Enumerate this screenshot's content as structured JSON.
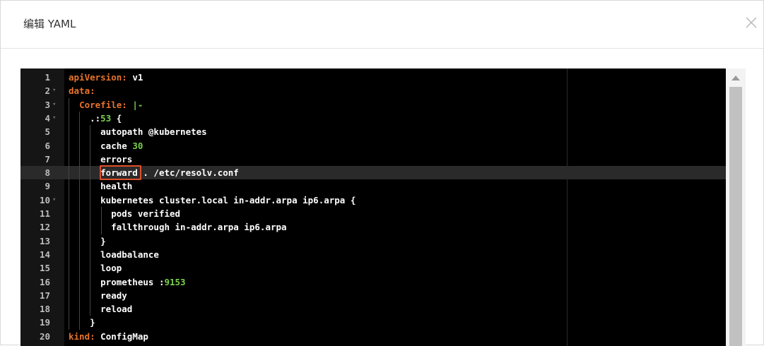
{
  "dialog": {
    "title": "编辑 YAML",
    "close_icon": "close-icon"
  },
  "editor": {
    "active_line": 8,
    "highlighted_token": "forward",
    "lines": [
      {
        "n": "1",
        "fold": false,
        "indent": "",
        "parts": [
          {
            "t": "apiVersion:",
            "c": "k"
          },
          {
            "t": " v1",
            "c": "w"
          }
        ]
      },
      {
        "n": "2",
        "fold": true,
        "indent": "",
        "parts": [
          {
            "t": "data:",
            "c": "k"
          }
        ]
      },
      {
        "n": "3",
        "fold": true,
        "indent": "  ",
        "parts": [
          {
            "t": "Corefile:",
            "c": "k"
          },
          {
            "t": " |-",
            "c": "n"
          }
        ]
      },
      {
        "n": "4",
        "fold": true,
        "indent": "    ",
        "parts": [
          {
            "t": ".:",
            "c": "w"
          },
          {
            "t": "53",
            "c": "n"
          },
          {
            "t": " {",
            "c": "w"
          }
        ]
      },
      {
        "n": "5",
        "fold": false,
        "indent": "      ",
        "parts": [
          {
            "t": "autopath @kubernetes",
            "c": "w"
          }
        ]
      },
      {
        "n": "6",
        "fold": false,
        "indent": "      ",
        "parts": [
          {
            "t": "cache ",
            "c": "w"
          },
          {
            "t": "30",
            "c": "n"
          }
        ]
      },
      {
        "n": "7",
        "fold": false,
        "indent": "      ",
        "parts": [
          {
            "t": "errors",
            "c": "w"
          }
        ]
      },
      {
        "n": "8",
        "fold": false,
        "indent": "      ",
        "parts": [
          {
            "t": "forward",
            "c": "w"
          },
          {
            "t": " . /etc/resolv.conf",
            "c": "w"
          }
        ]
      },
      {
        "n": "9",
        "fold": false,
        "indent": "      ",
        "parts": [
          {
            "t": "health",
            "c": "w"
          }
        ]
      },
      {
        "n": "10",
        "fold": true,
        "indent": "      ",
        "parts": [
          {
            "t": "kubernetes cluster.local in-addr.arpa ip6.arpa {",
            "c": "w"
          }
        ]
      },
      {
        "n": "11",
        "fold": false,
        "indent": "        ",
        "parts": [
          {
            "t": "pods verified",
            "c": "w"
          }
        ]
      },
      {
        "n": "12",
        "fold": false,
        "indent": "        ",
        "parts": [
          {
            "t": "fallthrough in-addr.arpa ip6.arpa",
            "c": "w"
          }
        ]
      },
      {
        "n": "13",
        "fold": false,
        "indent": "      ",
        "parts": [
          {
            "t": "}",
            "c": "w"
          }
        ]
      },
      {
        "n": "14",
        "fold": false,
        "indent": "      ",
        "parts": [
          {
            "t": "loadbalance",
            "c": "w"
          }
        ]
      },
      {
        "n": "15",
        "fold": false,
        "indent": "      ",
        "parts": [
          {
            "t": "loop",
            "c": "w"
          }
        ]
      },
      {
        "n": "16",
        "fold": false,
        "indent": "      ",
        "parts": [
          {
            "t": "prometheus :",
            "c": "w"
          },
          {
            "t": "9153",
            "c": "n"
          }
        ]
      },
      {
        "n": "17",
        "fold": false,
        "indent": "      ",
        "parts": [
          {
            "t": "ready",
            "c": "w"
          }
        ]
      },
      {
        "n": "18",
        "fold": false,
        "indent": "      ",
        "parts": [
          {
            "t": "reload",
            "c": "w"
          }
        ]
      },
      {
        "n": "19",
        "fold": false,
        "indent": "    ",
        "parts": [
          {
            "t": "}",
            "c": "w"
          }
        ]
      },
      {
        "n": "20",
        "fold": false,
        "indent": "",
        "parts": [
          {
            "t": "kind:",
            "c": "k"
          },
          {
            "t": " ConfigMap",
            "c": "w"
          }
        ]
      }
    ]
  },
  "colors": {
    "key": "#e7732b",
    "number": "#7ad04a",
    "text": "#ffffff",
    "highlight_box": "#e0502a",
    "editor_bg": "#000000"
  }
}
